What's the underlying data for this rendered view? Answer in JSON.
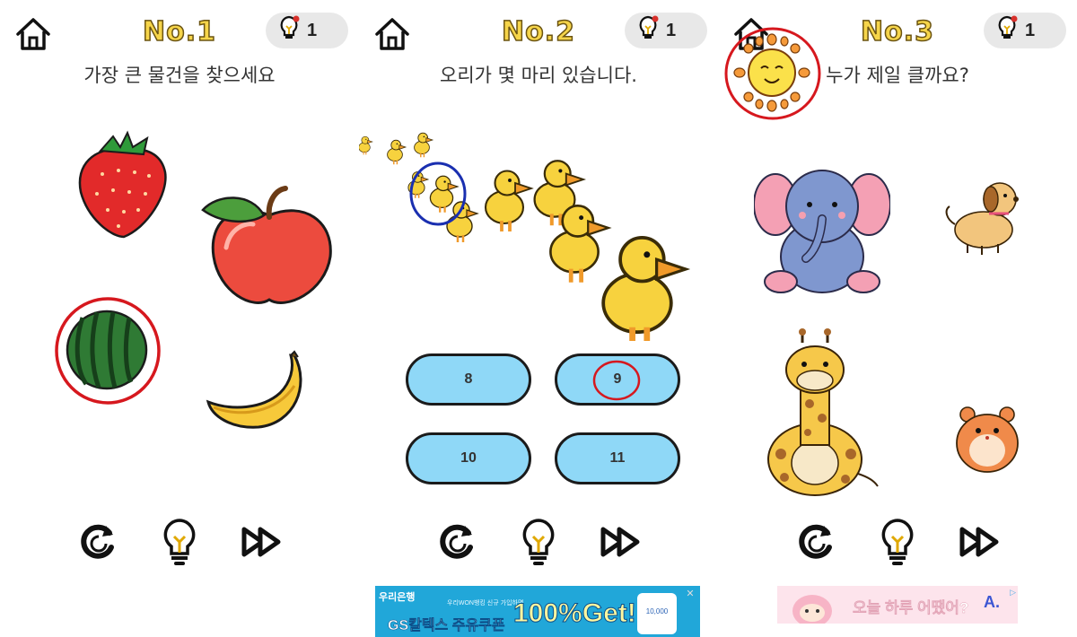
{
  "panels": [
    {
      "title": "No.1",
      "hint_count": "1",
      "question": "가장 큰 물건을 찾으세요",
      "objects": [
        "strawberry",
        "apple",
        "watermelon",
        "banana"
      ]
    },
    {
      "title": "No.2",
      "hint_count": "1",
      "question": "오리가 몇 마리 있습니다.",
      "answers": [
        "8",
        "9",
        "10",
        "11"
      ]
    },
    {
      "title": "No.3",
      "hint_count": "1",
      "question": "누가 제일 클까요?",
      "objects": [
        "sun",
        "elephant",
        "dog",
        "giraffe",
        "hamster"
      ]
    }
  ],
  "controls": [
    "restart-icon",
    "lightbulb-icon",
    "fast-forward-icon"
  ],
  "ad1": {
    "brand": "우리은행",
    "small": "우리WON뱅킹 신규 가입하면",
    "subtitle": "GS칼텍스 주유쿠폰",
    "headline": "100%Get!",
    "card_text": "10,000"
  },
  "ad2": {
    "text": "오늘 하루 어땠어?",
    "logo": "A."
  },
  "colors": {
    "title_yellow": "#F6D54A",
    "answer_blue": "#8fd8f7",
    "marker_red": "#d6181e",
    "marker_blue": "#1a2fb0"
  }
}
